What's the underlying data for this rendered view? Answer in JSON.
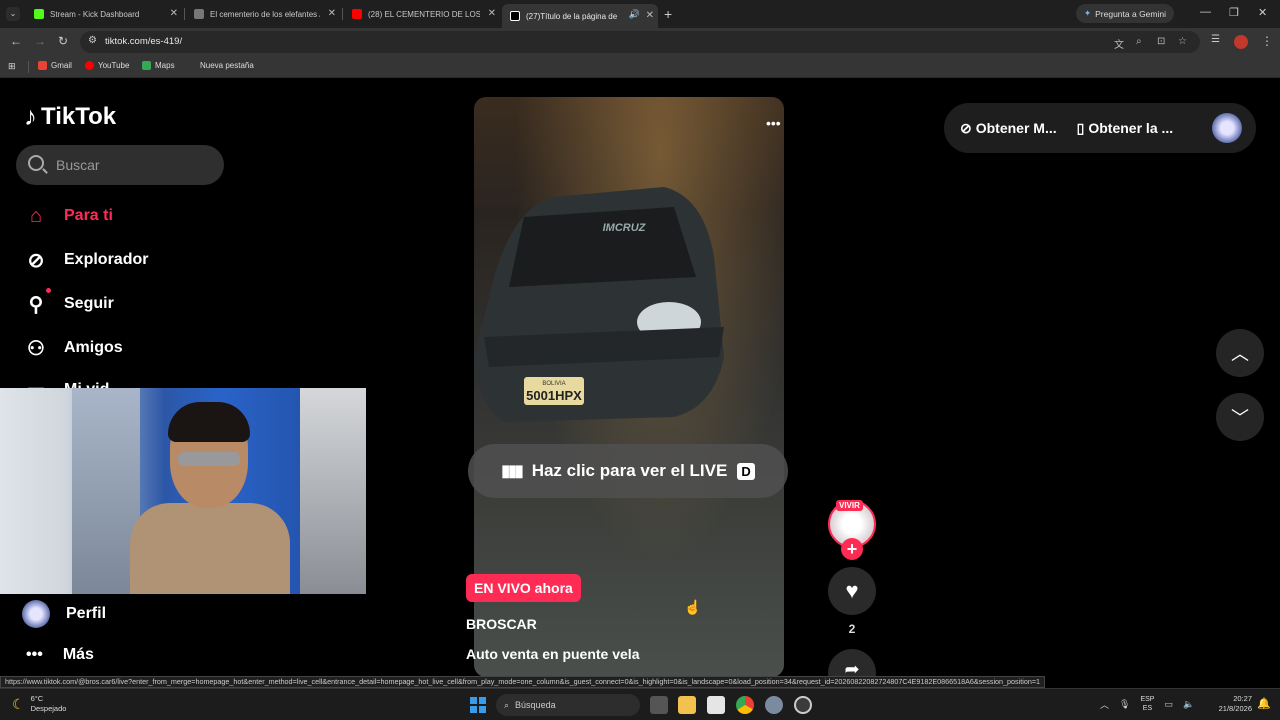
{
  "browser": {
    "tabs": [
      {
        "label": "Stream - Kick Dashboard",
        "color": "#53fc18",
        "active": false
      },
      {
        "label": "El cementerio de los elefantes / ",
        "color": "#8a8a8a",
        "active": false
      },
      {
        "label": "(28) EL CEMENTERIO DE LOS E",
        "color": "#ff0000",
        "active": false
      },
      {
        "label": "(27)Título de la página de",
        "color": "#ffffff",
        "active": true
      }
    ],
    "new_tab_label": "+",
    "gemini_label": "Pregunta a Gemini",
    "url": "tiktok.com/es-419/",
    "bookmarks": [
      {
        "label": "Gmail",
        "color": "#ea4335"
      },
      {
        "label": "YouTube",
        "color": "#ff0000"
      },
      {
        "label": "Maps",
        "color": "#34a853"
      },
      {
        "label": "Nueva pestaña",
        "color": ""
      }
    ]
  },
  "tiktok": {
    "logo": "TikTok",
    "search_placeholder": "Buscar",
    "nav": [
      {
        "label": "Para ti",
        "icon": "home-icon"
      },
      {
        "label": "Explorador",
        "icon": "compass-icon"
      },
      {
        "label": "Seguir",
        "icon": "user-follow-icon"
      },
      {
        "label": "Amigos",
        "icon": "friends-icon"
      }
    ],
    "partial_nav_label": "Mi vid",
    "perfil_label": "Perfil",
    "mas_label": "Más",
    "topbar": {
      "item1": "Obtener M...",
      "item2": "Obtener la ..."
    },
    "live_button": "Haz clic para ver el LIVE",
    "live_key": "D",
    "live_badge": "EN VIVO ahora",
    "username": "BROSCAR",
    "caption": "Auto venta en puente vela",
    "avatar_label": "VIVIR",
    "like_count": "2",
    "plate_top": "BOLIVIA",
    "plate_number": "5001HPX",
    "windshield_text": "IMCRUZ",
    "accent": "#fe2c55"
  },
  "status_url": "https://www.tiktok.com/@bros.car6/live?enter_from_merge=homepage_hot&enter_method=live_cell&entrance_detail=homepage_hot_live_cell&from_play_mode=one_column&is_guest_connect=0&is_highlight=0&is_landscape=0&load_position=34&request_id=20260822082724807C4E9182E0866518A6&session_position=1",
  "taskbar": {
    "temp": "6°C",
    "weather": "Despejado",
    "search_label": "Búsqueda",
    "lang1": "ESP",
    "lang2": "ES",
    "time": "20:27",
    "date": "21/8/2026"
  }
}
